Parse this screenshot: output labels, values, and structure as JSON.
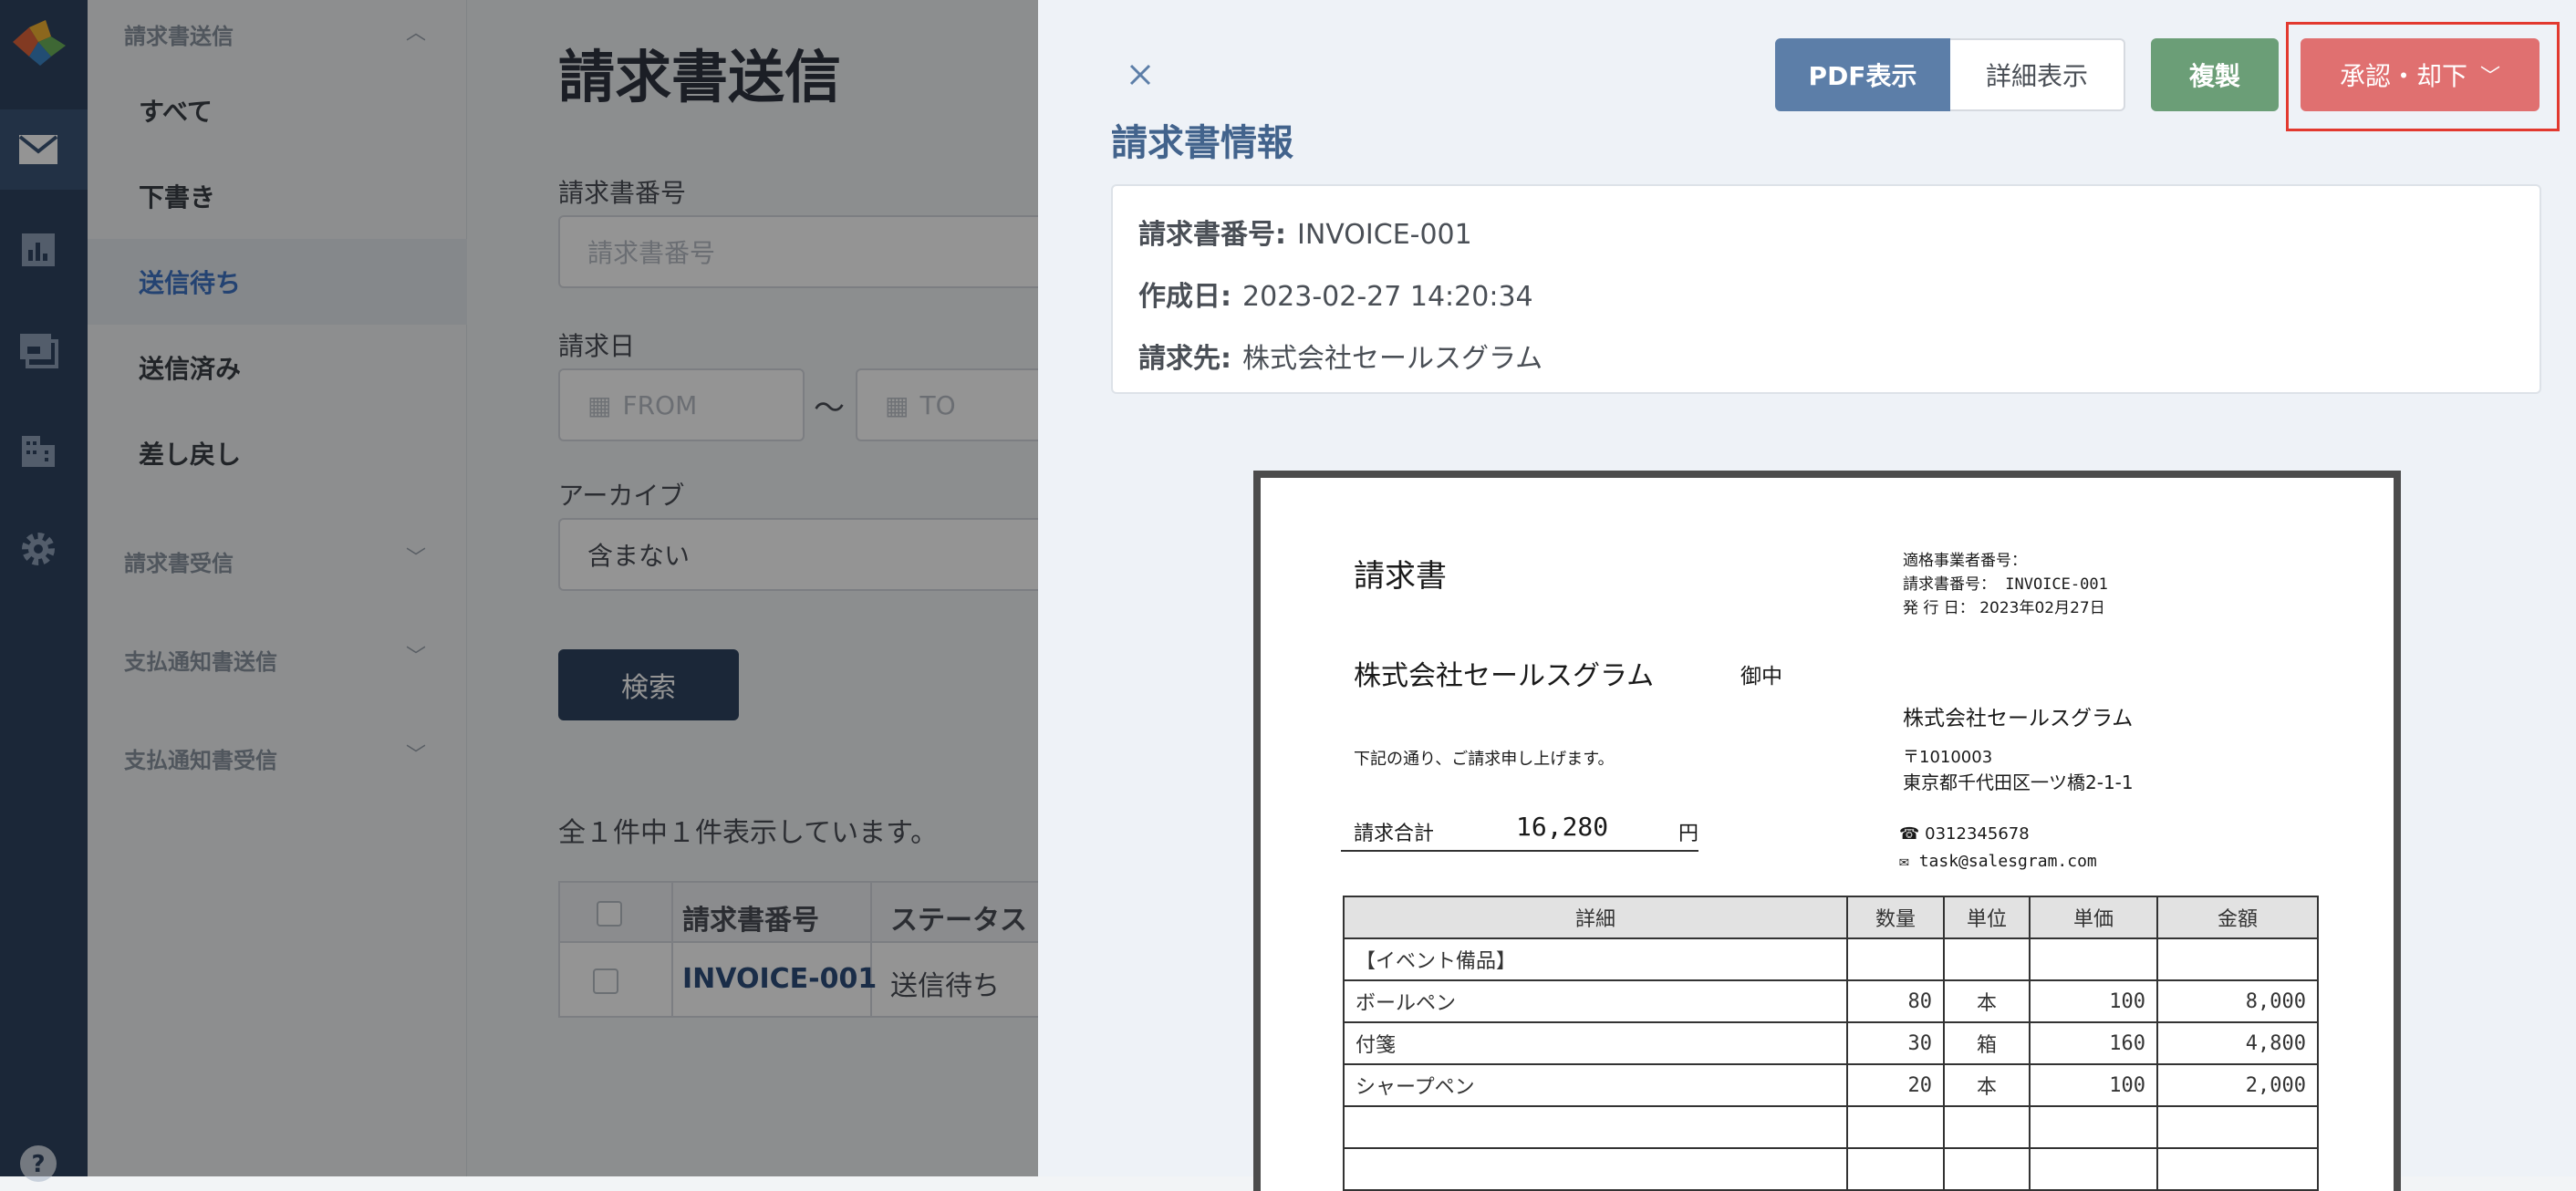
{
  "nav": {
    "groups": {
      "invoice_send": "請求書送信",
      "invoice_receive": "請求書受信",
      "payment_send": "支払通知書送信",
      "payment_receive": "支払通知書受信"
    },
    "items": [
      "すべて",
      "下書き",
      "送信待ち",
      "送信済み",
      "差し戻し"
    ]
  },
  "page": {
    "title": "請求書送信",
    "invoice_no_label": "請求書番号",
    "invoice_no_placeholder": "請求書番号",
    "date_label": "請求日",
    "from_placeholder": "FROM",
    "tilde": "〜",
    "to_placeholder": "TO",
    "archive_label": "アーカイブ",
    "archive_value": "含まない",
    "search_button": "検索",
    "count_text": "全１件中１件表示しています。",
    "table": {
      "headers": [
        "請求書番号",
        "ステータス"
      ],
      "row": {
        "invoice_no": "INVOICE-001",
        "status": "送信待ち"
      }
    }
  },
  "drawer": {
    "pdf_button": "PDF表示",
    "detail_button": "詳細表示",
    "copy_button": "複製",
    "approve_button": "承認・却下",
    "section_title": "請求書情報",
    "info": {
      "invoice_no_label": "請求書番号:",
      "invoice_no": "INVOICE-001",
      "created_label": "作成日:",
      "created": "2023-02-27 14:20:34",
      "billto_label": "請求先:",
      "billto": "株式会社セールスグラム"
    }
  },
  "pdf": {
    "title": "請求書",
    "reg_no_label": "適格事業者番号：",
    "invoice_no_line": "請求書番号： INVOICE-001",
    "issue_line": "発 行 日： 2023年02月27日",
    "customer": "株式会社セールスグラム",
    "honorific": "御中",
    "sender": "株式会社セールスグラム",
    "greeting": "下記の通り、ご請求申し上げます。",
    "zip": "〒1010003",
    "address": "東京都千代田区一ツ橋2-1-1",
    "total_label": "請求合計",
    "total": "16,280",
    "yen": "円",
    "phone": "0312345678",
    "email": "task@salesgram.com",
    "columns": [
      "詳細",
      "数量",
      "単位",
      "単価",
      "金額"
    ],
    "rows": [
      {
        "detail": "【イベント備品】",
        "qty": "",
        "unit": "",
        "price": "",
        "amount": ""
      },
      {
        "detail": "ボールペン",
        "qty": "80",
        "unit": "本",
        "price": "100",
        "amount": "8,000"
      },
      {
        "detail": "付箋",
        "qty": "30",
        "unit": "箱",
        "price": "160",
        "amount": "4,800"
      },
      {
        "detail": "シャープペン",
        "qty": "20",
        "unit": "本",
        "price": "100",
        "amount": "2,000"
      },
      {
        "detail": "",
        "qty": "",
        "unit": "",
        "price": "",
        "amount": ""
      },
      {
        "detail": "",
        "qty": "",
        "unit": "",
        "price": "",
        "amount": ""
      }
    ]
  },
  "colors": {
    "rail": "#2f4461",
    "accent": "#3f74c4",
    "pdf_button": "#5c7ea8",
    "copy_button": "#6b9e77",
    "approve_button": "#e07070",
    "highlight": "#e2392f"
  }
}
